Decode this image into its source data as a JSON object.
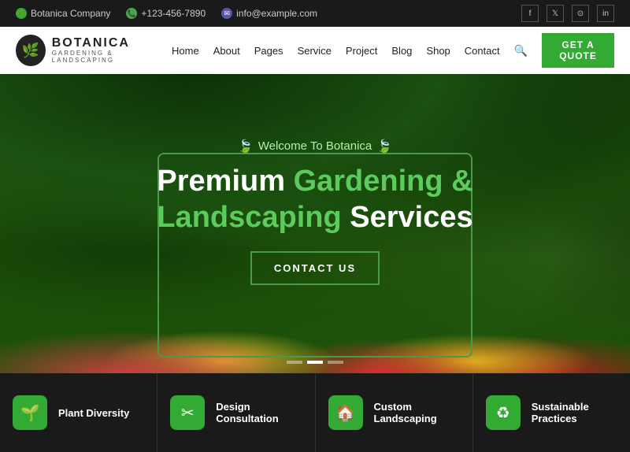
{
  "topbar": {
    "company": "Botanica Company",
    "phone": "+123-456-7890",
    "email": "info@example.com",
    "socials": [
      "f",
      "X",
      "in",
      "in"
    ]
  },
  "header": {
    "logo_name": "BOTANICA",
    "logo_sub": "GARDENING & LANDSCAPING",
    "nav_items": [
      "Home",
      "About",
      "Pages",
      "Service",
      "Project",
      "Blog",
      "Shop",
      "Contact"
    ],
    "cta_label": "GET A QUOTE"
  },
  "hero": {
    "welcome": "Welcome To Botanica",
    "title_line1": "Premium",
    "title_green1": "Gardening &",
    "title_green2": "Landscaping",
    "title_line2": "Services",
    "cta_label": "CONTACT US",
    "slides": [
      "",
      "",
      ""
    ]
  },
  "cards": [
    {
      "icon": "🌱",
      "label": "Plant Diversity"
    },
    {
      "icon": "✂",
      "label": "Design Consultation"
    },
    {
      "icon": "🏠",
      "label": "Custom Landscaping"
    },
    {
      "icon": "♻",
      "label": "Sustainable Practices"
    }
  ]
}
